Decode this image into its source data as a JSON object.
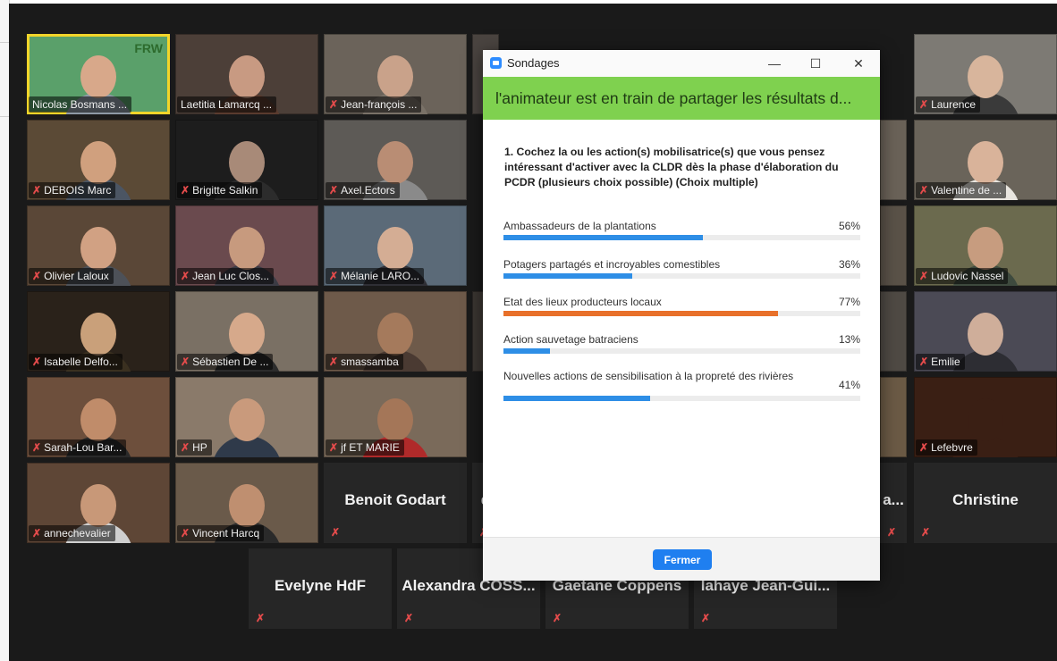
{
  "participants": [
    {
      "name": "Nicolas Bosmans ...",
      "muted": false,
      "bg": "#5aa06a",
      "head": "#d8a88a",
      "body": "#8f9aa6",
      "logo": "FRW"
    },
    {
      "name": "Laetitia Lamarcq ...",
      "muted": false,
      "bg": "#4c3f38",
      "head": "#c89a82",
      "body": "#5a3b2e"
    },
    {
      "name": "Jean-françois ...",
      "muted": true,
      "bg": "#6b635a",
      "head": "#c9a28a",
      "body": "#7a7268"
    },
    {
      "name": "Laurence",
      "muted": true,
      "bg": "#7d7a74",
      "head": "#d8b59c",
      "body": "#3a3a3a"
    },
    {
      "name": "DEBOIS Marc",
      "muted": true,
      "bg": "#5b4a36",
      "head": "#d0a07e",
      "body": "#4b5563"
    },
    {
      "name": "Brigitte Salkin",
      "muted": true,
      "bg": "#1d1d1d",
      "head": "#a88a78",
      "body": "#2c2c2c"
    },
    {
      "name": "Axel.Ectors",
      "muted": true,
      "bg": "#5d5a56",
      "head": "#b98d74",
      "body": "#8a8a8a"
    },
    {
      "name": "Valentine de ...",
      "muted": true,
      "bg": "#6a645a",
      "head": "#d9b39a",
      "body": "#e9e6e0"
    },
    {
      "name": "Olivier Laloux",
      "muted": true,
      "bg": "#5a4737",
      "head": "#d1a183",
      "body": "#4d5158"
    },
    {
      "name": "Jean Luc Clos...",
      "muted": true,
      "bg": "#6a4a4e",
      "head": "#c79a7e",
      "body": "#3b3b44"
    },
    {
      "name": "Mélanie LARO...",
      "muted": true,
      "bg": "#5b6a78",
      "head": "#d4ad94",
      "body": "#2f2f35"
    },
    {
      "name": "Ludovic Nassel",
      "muted": true,
      "bg": "#6b6a4e",
      "head": "#c79c7f",
      "body": "#3e4a3e"
    },
    {
      "name": "Isabelle Delfo...",
      "muted": true,
      "bg": "#2a221a",
      "head": "#c9a07a",
      "body": "#3a3020"
    },
    {
      "name": "Sébastien De ...",
      "muted": true,
      "bg": "#7a7064",
      "head": "#d6a98b",
      "body": "#2c2c2c"
    },
    {
      "name": "smassamba",
      "muted": true,
      "bg": "#6e5a4a",
      "head": "#a57a5c",
      "body": "#4a3a32"
    },
    {
      "name": "Emilie",
      "muted": true,
      "bg": "#4b4a55",
      "head": "#cfae9a",
      "body": "#2d2d33"
    },
    {
      "name": "Sarah-Lou Bar...",
      "muted": true,
      "bg": "#6d4f3c",
      "head": "#c08c6a",
      "body": "#2a2a2a"
    },
    {
      "name": "HP",
      "muted": true,
      "bg": "#8a7a6a",
      "head": "#c99a7c",
      "body": "#2f3a4a"
    },
    {
      "name": "jf ET MARIE",
      "muted": true,
      "bg": "#7a6a5a",
      "head": "#a47658",
      "body": "#b02a2a"
    },
    {
      "name": "Lefebvre",
      "muted": true,
      "bg": "#3a1f14",
      "head": "#3a1f14",
      "body": "#3a1f14"
    },
    {
      "name": "annechevalier",
      "muted": true,
      "bg": "#5e4636",
      "head": "#c89878",
      "body": "#cfcfcf"
    },
    {
      "name": "Vincent Harcq",
      "muted": true,
      "bg": "#6a5a4a",
      "head": "#bf8f70",
      "body": "#2a2a2a"
    }
  ],
  "name_tiles": [
    {
      "name": "Benoit Godart"
    },
    {
      "name": "d"
    },
    {
      "name": "a..."
    },
    {
      "name": "Christine"
    },
    {
      "name": "Evelyne HdF"
    },
    {
      "name": "Alexandra  COSS..."
    },
    {
      "name": "Gaetane Coppens"
    },
    {
      "name": "lahaye  Jean-Gui..."
    }
  ],
  "poll": {
    "window_title": "Sondages",
    "minimize": "—",
    "maximize": "☐",
    "close": "✕",
    "banner": "l'animateur est en train de partager les résultats d...",
    "question": "1. Cochez la ou les action(s) mobilisatrice(s) que vous pensez intéressant d'activer avec la CLDR dès la phase d'élaboration du PCDR (plusieurs choix possible) (Choix multiple)",
    "options": [
      {
        "label": "Ambassadeurs de la plantations",
        "percent_label": "56%",
        "percent": 56,
        "color": "#2e8ee6"
      },
      {
        "label": "Potagers partagés et incroyables comestibles",
        "percent_label": "36%",
        "percent": 36,
        "color": "#2e8ee6"
      },
      {
        "label": "Etat des lieux producteurs locaux",
        "percent_label": "77%",
        "percent": 77,
        "color": "#e8702a"
      },
      {
        "label": "Action sauvetage batraciens",
        "percent_label": "13%",
        "percent": 13,
        "color": "#2e8ee6"
      },
      {
        "label": "Nouvelles actions de sensibilisation à la propreté des rivières",
        "percent_label": "41%",
        "percent": 41,
        "color": "#2e8ee6"
      }
    ],
    "close_button": "Fermer"
  },
  "mic_glyph": "✗"
}
